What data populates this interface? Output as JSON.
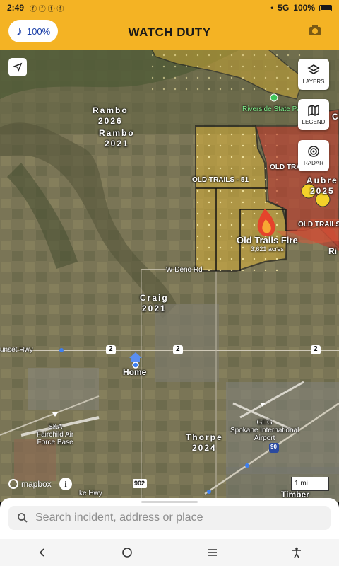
{
  "status_bar": {
    "time": "2:49",
    "notifications": "ⓕ ⓕ ⓕ ⓕ",
    "network": "5G",
    "battery": "100%"
  },
  "header": {
    "title": "WATCH DUTY",
    "audio_level": "100%"
  },
  "map": {
    "buttons": {
      "layers": "LAYERS",
      "legend": "LEGEND",
      "radar": "RADAR"
    },
    "labels": {
      "rambo_2026_name": "Rambo",
      "rambo_2026_year": "2026",
      "rambo_2021_name": "Rambo",
      "rambo_2021_year": "2021",
      "riverside": "Riverside State Pa",
      "perimeter_51": "OLD TRAILS - 51",
      "old_trails_right_1": "OLD TRA",
      "old_trails_right_2": "OLD TRAILS",
      "aubrey_name": "Aubre",
      "aubrey_year": "2025",
      "fire_name": "Old Trails Fire",
      "fire_acres": "3,621 acres",
      "deno_rd": "W Deno Rd",
      "craig_name": "Craig",
      "craig_year": "2021",
      "sunset_hwy": "unset Hwy",
      "home": "Home",
      "geg_1": "GEG",
      "geg_2": "Spokane International",
      "geg_3": "Airport",
      "ska_1": "SKA",
      "ska_2": "Fairchild Air",
      "ska_3": "Force Base",
      "thorpe_name": "Thorpe",
      "thorpe_year": "2024",
      "timber": "Timber",
      "ri_edge": "Ri",
      "c_edge": "C",
      "lake_hwy": "ke Hwy",
      "sign_2a": "2",
      "sign_2b": "2",
      "sign_2c": "2",
      "sign_902": "902",
      "sign_90": "90"
    },
    "attribution": "mapbox",
    "info": "i",
    "scale": "1 mi"
  },
  "search": {
    "placeholder": "Search incident, address or place"
  },
  "colors": {
    "brand": "#f4b324",
    "fire_red": "#c0392b",
    "perimeter_fill": "#d9b13a"
  }
}
